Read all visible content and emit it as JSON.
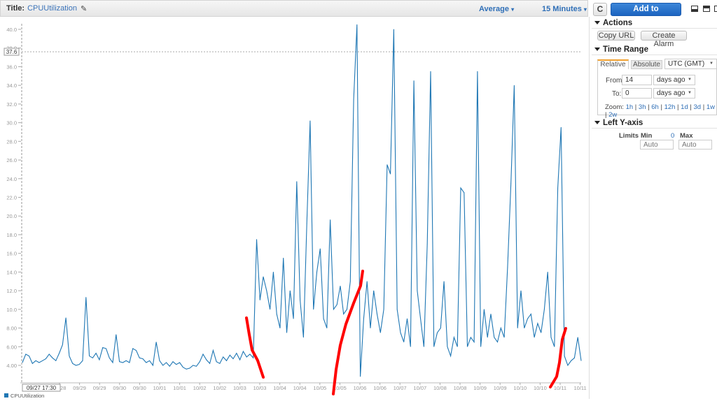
{
  "header": {
    "title_label": "Title:",
    "title_value": "CPUUtilization",
    "statistic": "Average",
    "period": "15 Minutes"
  },
  "panel": {
    "refresh_icon": "refresh-icon",
    "add_to_dashboard": "Add to Dashboard",
    "actions": {
      "heading": "Actions",
      "copy_url": "Copy URL",
      "create_alarm": "Create Alarm"
    },
    "time_range": {
      "heading": "Time Range",
      "tabs": [
        "Relative",
        "Absolute"
      ],
      "active_tab": "Relative",
      "timezone": "UTC (GMT)",
      "from_label": "From:",
      "from_value": "14",
      "from_unit": "days ago",
      "to_label": "To:",
      "to_value": "0",
      "to_unit": "days ago",
      "zoom_label": "Zoom:",
      "zoom_options": [
        "1h",
        "3h",
        "6h",
        "12h",
        "1d",
        "3d",
        "1w",
        "2w"
      ]
    },
    "left_y_axis": {
      "heading": "Left Y-axis",
      "limits_label": "Limits",
      "min_label": "Min",
      "min_value_shown": "0",
      "max_label": "Max",
      "min_placeholder": "Auto",
      "max_placeholder": "Auto"
    }
  },
  "chart_data": {
    "type": "line",
    "title": "",
    "xlabel": "",
    "ylabel": "",
    "ylim": [
      3,
      41
    ],
    "yticks": [
      "4.00",
      "6.00",
      "8.00",
      "10.0",
      "12.0",
      "14.0",
      "16.0",
      "18.0",
      "20.0",
      "22.0",
      "24.0",
      "26.0",
      "28.0",
      "30.0",
      "32.0",
      "34.0",
      "36.0",
      "38.0",
      "40.0"
    ],
    "xticks": [
      "09/28",
      "09/29",
      "09/29",
      "09/30",
      "09/30",
      "10/01",
      "10/01",
      "10/02",
      "10/02",
      "10/03",
      "10/03",
      "10/04",
      "10/04",
      "10/05",
      "10/05",
      "10/06",
      "10/06",
      "10/07",
      "10/07",
      "10/08",
      "10/08",
      "10/09",
      "10/09",
      "10/10",
      "10/10",
      "10/11",
      "10/11"
    ],
    "crosshair": {
      "time": "09/27 17:30",
      "value": "37.6"
    },
    "grid": false,
    "legend_position": "bottom-left",
    "series": [
      {
        "name": "CPUUtilization",
        "color": "#1f77b4",
        "values": [
          4.3,
          5.2,
          5.0,
          4.2,
          4.5,
          4.3,
          4.5,
          4.7,
          5.2,
          4.8,
          4.5,
          5.3,
          6.2,
          9.1,
          5.0,
          4.2,
          4.0,
          4.1,
          4.5,
          11.3,
          5.0,
          4.8,
          5.3,
          4.6,
          5.9,
          5.8,
          4.8,
          4.3,
          7.3,
          4.4,
          4.3,
          4.5,
          4.3,
          5.8,
          5.6,
          4.8,
          4.7,
          4.3,
          4.5,
          4.0,
          6.5,
          4.5,
          4.0,
          4.3,
          3.9,
          4.4,
          4.1,
          4.3,
          3.8,
          3.6,
          3.7,
          4.0,
          3.9,
          4.4,
          5.2,
          4.6,
          4.2,
          5.6,
          4.4,
          4.2,
          4.9,
          4.5,
          5.1,
          4.7,
          5.3,
          4.6,
          5.5,
          4.9,
          5.2,
          4.8,
          17.5,
          11.0,
          13.5,
          12.0,
          10.0,
          14.0,
          9.5,
          8.0,
          15.5,
          7.5,
          12.0,
          9.0,
          23.7,
          11.0,
          7.0,
          19.2,
          30.2,
          10.0,
          14.0,
          16.5,
          9.0,
          8.0,
          19.6,
          10.0,
          10.5,
          12.5,
          9.5,
          10.0,
          13.0,
          32.5,
          40.5,
          2.8,
          9.0,
          13.0,
          8.0,
          12.0,
          9.5,
          7.5,
          10.0,
          25.5,
          24.5,
          40.0,
          10.0,
          7.5,
          6.5,
          9.0,
          6.0,
          34.5,
          12.0,
          9.0,
          6.0,
          17.0,
          35.5,
          6.0,
          7.5,
          8.0,
          13.0,
          6.0,
          5.0,
          7.0,
          6.0,
          23.0,
          22.5,
          6.0,
          7.0,
          6.5,
          35.5,
          6.0,
          10.0,
          7.0,
          9.5,
          7.0,
          6.5,
          8.0,
          7.0,
          14.5,
          23.5,
          34.0,
          8.0,
          12.0,
          8.0,
          9.0,
          9.5,
          7.0,
          8.5,
          7.5,
          10.0,
          14.0,
          7.0,
          6.0,
          23.0,
          29.5,
          5.0,
          4.0,
          4.5,
          4.8,
          7.0,
          4.5
        ]
      }
    ]
  }
}
